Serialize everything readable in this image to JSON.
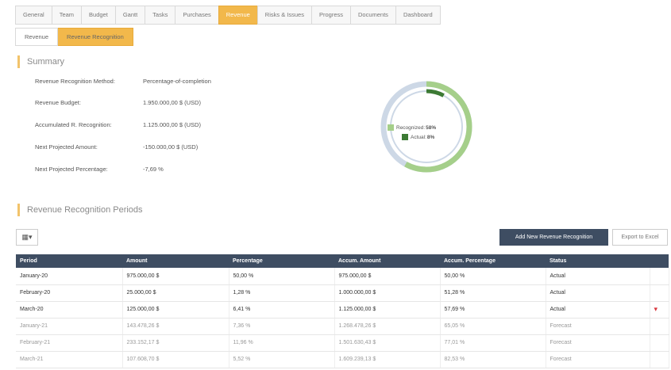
{
  "tabs": [
    "General",
    "Team",
    "Budget",
    "Gantt",
    "Tasks",
    "Purchases",
    "Revenue",
    "Risks & Issues",
    "Progress",
    "Documents",
    "Dashboard"
  ],
  "active_tab": "Revenue",
  "subtabs": [
    "Revenue",
    "Revenue Recognition"
  ],
  "summary": {
    "title": "Summary",
    "rows": [
      {
        "label": "Revenue Recognition Method:",
        "value": "Percentage-of-completion"
      },
      {
        "label": "Revenue Budget:",
        "value": "1.950.000,00 $ (USD)"
      },
      {
        "label": "Accumulated R. Recognition:",
        "value": "1.125.000,00 $ (USD)"
      },
      {
        "label": "Next Projected Amount:",
        "value": "-150.000,00 $ (USD)"
      },
      {
        "label": "Next Projected Percentage:",
        "value": "-7,69 %"
      }
    ]
  },
  "donut": {
    "legend": [
      {
        "label": "Recognized:",
        "value": "58%",
        "color": "#a5cf8a"
      },
      {
        "label": "Actual:",
        "value": "8%",
        "color": "#3c7a34"
      }
    ],
    "recognized_fraction": 0.58,
    "actual_fraction": 0.08,
    "track_color": "#cdd8e6"
  },
  "periods": {
    "title": "Revenue Recognition Periods",
    "columns_button": "▦▾",
    "add_button": "Add New Revenue Recognition",
    "export_button": "Export to Excel",
    "headers": [
      "Period",
      "Amount",
      "Percentage",
      "Accum. Amount",
      "Accum. Percentage",
      "Status",
      ""
    ],
    "rows": [
      {
        "period": "January-20",
        "amount": "975.000,00 $",
        "percentage": "50,00 %",
        "accum_amount": "975.000,00 $",
        "accum_percentage": "50,00 %",
        "status": "Actual",
        "flag": ""
      },
      {
        "period": "February-20",
        "amount": "25.000,00 $",
        "percentage": "1,28 %",
        "accum_amount": "1.000.000,00 $",
        "accum_percentage": "51,28 %",
        "status": "Actual",
        "flag": ""
      },
      {
        "period": "March-20",
        "amount": "125.000,00 $",
        "percentage": "6,41 %",
        "accum_amount": "1.125.000,00 $",
        "accum_percentage": "57,69 %",
        "status": "Actual",
        "flag": "▾"
      },
      {
        "period": "January-21",
        "amount": "143.478,26 $",
        "percentage": "7,36 %",
        "accum_amount": "1.268.478,26 $",
        "accum_percentage": "65,05 %",
        "status": "Forecast",
        "flag": ""
      },
      {
        "period": "February-21",
        "amount": "233.152,17 $",
        "percentage": "11,96 %",
        "accum_amount": "1.501.630,43 $",
        "accum_percentage": "77,01 %",
        "status": "Forecast",
        "flag": ""
      },
      {
        "period": "March-21",
        "amount": "107.608,70 $",
        "percentage": "5,52 %",
        "accum_amount": "1.609.239,13 $",
        "accum_percentage": "82,53 %",
        "status": "Forecast",
        "flag": ""
      }
    ]
  }
}
